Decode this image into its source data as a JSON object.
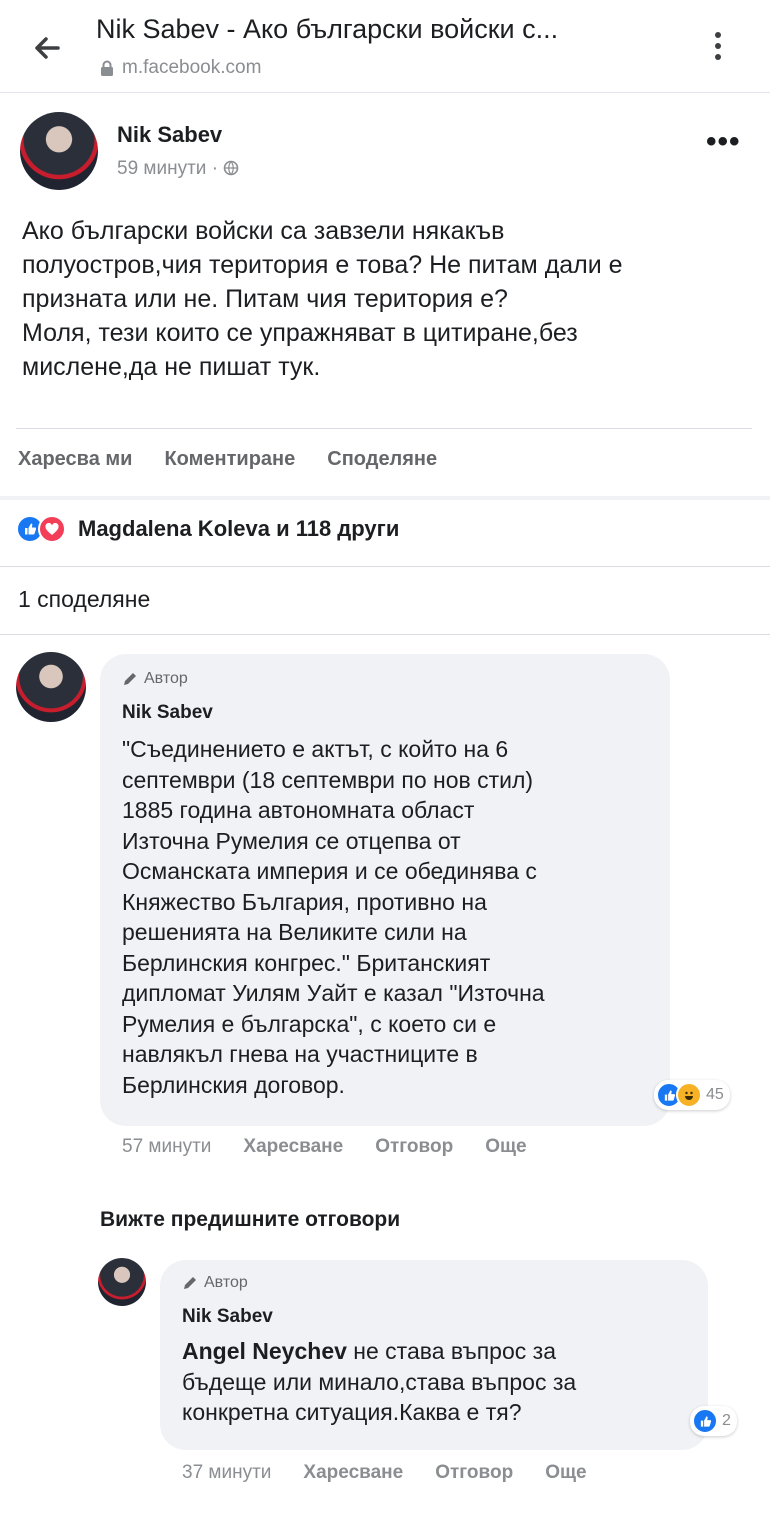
{
  "browser": {
    "title": "Nik Sabev - Ако български войски с...",
    "url": "m.facebook.com",
    "icons": {
      "back": "back-arrow-icon",
      "lock": "lock-icon",
      "menu": "kebab-menu-icon"
    }
  },
  "post": {
    "author": "Nik Sabev",
    "time": "59 минути",
    "audience_icon": "globe-icon",
    "more": "•••",
    "text_lines": [
      "Ако български войски са завзели някакъв",
      "полуостров,чия територия е това? Не питам дали е",
      "призната или не. Питам чия територия е?",
      "Моля, тези които се упражняват в цитиране,без",
      "мислене,да не пишат тук."
    ],
    "actions": {
      "like": "Харесва ми",
      "comment": "Коментиране",
      "share": "Споделяне"
    },
    "reactions_text": "Magdalena Koleva и 118 други",
    "shares_text": "1 споделяне"
  },
  "comments": [
    {
      "author_tag": "Автор",
      "name": "Nik Sabev",
      "text_lines": [
        "\"Съединението е актът, с който на 6",
        "септември (18 септември по нов стил)",
        "1885 година автономната област",
        "Източна Румелия се отцепва от",
        "Османската империя и се обединява с",
        "Княжество България, противно на",
        "решенията на Великите сили на",
        "Берлинския конгрес.\" Британският",
        "дипломат Уилям Уайт е казал \"Източна",
        "Румелия е българска\", с което си е",
        "навлякъл гнева на участниците в",
        "Берлинския договор."
      ],
      "reaction_count": "45",
      "time": "57 минути",
      "like": "Харесване",
      "reply": "Отговор",
      "more": "Още"
    }
  ],
  "view_previous": "Вижте предишните отговори",
  "reply": {
    "author_tag": "Автор",
    "name": "Nik Sabev",
    "mention": "Angel Neychev",
    "text_first": " не става въпрос за",
    "text_lines": [
      "бъдеще или минало,става въпрос за",
      "конкретна ситуация.Каква е тя?"
    ],
    "reaction_count": "2",
    "time": "37 минути",
    "like": "Харесване",
    "reply_label": "Отговор",
    "more": "Още"
  },
  "colors": {
    "like_blue": "#1877f2",
    "love_red": "#f33e58",
    "bubble_bg": "#f0f2f5",
    "muted": "#8a8d91"
  }
}
